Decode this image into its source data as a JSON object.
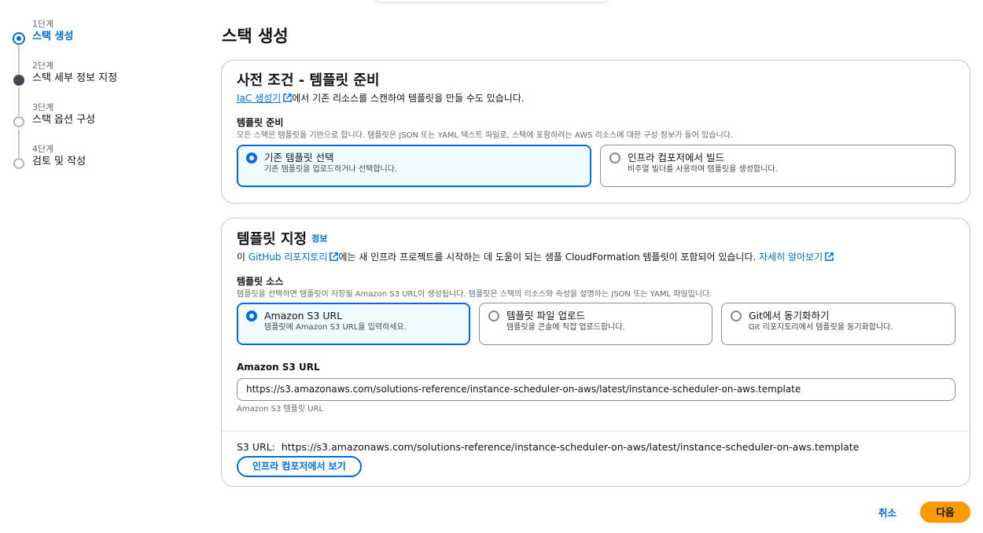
{
  "steps": [
    {
      "num": "1단계",
      "label": "스택 생성"
    },
    {
      "num": "2단계",
      "label": "스택 세부 정보 지정"
    },
    {
      "num": "3단계",
      "label": "스택 옵션 구성"
    },
    {
      "num": "4단계",
      "label": "검토 및 작성"
    }
  ],
  "page_title": "스택 생성",
  "prereq": {
    "title": "사전 조건 - 템플릿 준비",
    "desc_link": "IaC 생성기",
    "desc_rest": "에서 기존 리소스를 스캔하여 템플릿을 만들 수도 있습니다.",
    "field_label": "템플릿 준비",
    "field_desc": "모든 스택은 템플릿을 기반으로 합니다. 템플릿은 JSON 또는 YAML 텍스트 파일로, 스택에 포함하려는 AWS 리소스에 대한 구성 정보가 들어 있습니다.",
    "options": [
      {
        "title": "기존 템플릿 선택",
        "desc": "기존 템플릿을 업로드하거나 선택합니다."
      },
      {
        "title": "인프라 컴포저에서 빌드",
        "desc": "비주얼 빌더를 사용하여 템플릿을 생성합니다."
      }
    ]
  },
  "specify": {
    "title": "템플릿 지정",
    "info": "정보",
    "desc_pre": "이 ",
    "desc_link": "GitHub 리포지토리",
    "desc_mid": "에는 새 인프라 프로젝트를 시작하는 데 도움이 되는 샘플 CloudFormation 템플릿이 포함되어 있습니다. ",
    "desc_link2": "자세히 알아보기",
    "field_label": "템플릿 소스",
    "field_desc": "템플릿을 선택하면 템플릿이 저장될 Amazon S3 URL이 생성됩니다. 템플릿은 스택의 리소스와 속성을 설명하는 JSON 또는 YAML 파일입니다.",
    "sources": [
      {
        "title": "Amazon S3 URL",
        "desc": "템플릿에 Amazon S3 URL을 입력하세요."
      },
      {
        "title": "템플릿 파일 업로드",
        "desc": "템플릿을 콘솔에 직접 업로드합니다."
      },
      {
        "title": "Git에서 동기화하기",
        "desc": "Git 리포지토리에서 템플릿을 동기화합니다."
      }
    ],
    "url_label": "Amazon S3 URL",
    "url_value": "https://s3.amazonaws.com/solutions-reference/instance-scheduler-on-aws/latest/instance-scheduler-on-aws.template",
    "url_hint": "Amazon S3 템플릿 URL",
    "s3_prefix": "S3 URL:",
    "s3_value": "https://s3.amazonaws.com/solutions-reference/instance-scheduler-on-aws/latest/instance-scheduler-on-aws.template",
    "view_button": "인프라 컴포저에서 보기"
  },
  "footer": {
    "cancel": "취소",
    "next": "다음"
  },
  "colors": {
    "accent": "#006ce0",
    "primary_button": "#ff9900"
  }
}
